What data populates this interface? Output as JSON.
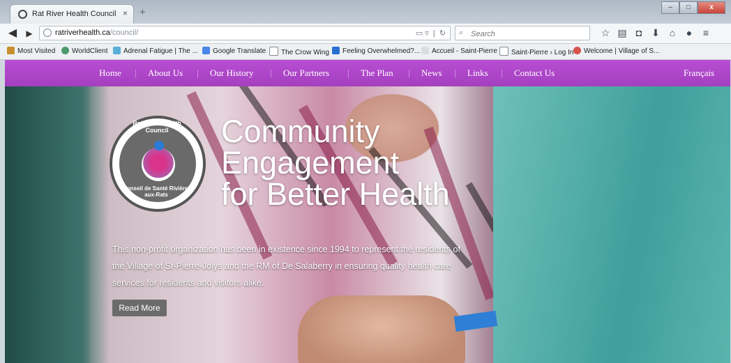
{
  "browser": {
    "tab_title": "Rat River Health Council",
    "tab_close": "×",
    "new_tab": "+",
    "window_controls": {
      "minimize": "–",
      "maximize": "□",
      "close": "x"
    },
    "url_host": "ratriverhealth.ca",
    "url_path": "/council/",
    "search_placeholder": "Search",
    "bookmarks": [
      "Most Visited",
      "WorldClient",
      "Adrenal Fatigue | The ...",
      "Google Translate",
      "The Crow Wing",
      "Feeling Overwhelmed?...",
      "Accueil - Saint-Pierre",
      "Saint-Pierre › Log In",
      "Welcome | Village of S..."
    ]
  },
  "site": {
    "menu": [
      "Home",
      "About Us",
      "Our History",
      "Our Partners",
      "The Plan",
      "News",
      "Links",
      "Contact Us"
    ],
    "language_link": "Français",
    "logo_top": "Rat River Health Council",
    "logo_bottom": "Conseil de Santé Rivière-aux-Rats",
    "headline": [
      "Community",
      "Engagement",
      "for Better Health"
    ],
    "blurb": "This non-profit organization has been in existence since 1994 to represent the residents of the Village of St-Pierre-Jolys and the RM of De Salaberry in ensuring quality health care services for residents and visitors alike.",
    "read_more": "Read More"
  },
  "colors": {
    "menu_purple": "#b04cce",
    "button_gray": "#6b6b6b"
  }
}
